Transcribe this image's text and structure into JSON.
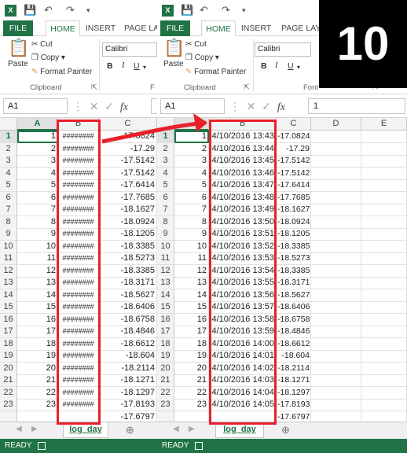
{
  "panes": [
    {
      "id": "paneL",
      "file_label": "FILE",
      "tabs": [
        "HOME",
        "INSERT",
        "PAGE LA"
      ],
      "font_name": "Calibri",
      "name_box": "A1",
      "formula": "",
      "columns": [
        "A",
        "B",
        "C"
      ],
      "col_b_values": [
        "########",
        "########",
        "########",
        "########",
        "########",
        "########",
        "########",
        "########",
        "########",
        "########",
        "########",
        "########",
        "########",
        "########",
        "########",
        "########",
        "########",
        "########",
        "########",
        "########",
        "########",
        "########",
        "########"
      ],
      "sheet_tab": "log_day",
      "status": "READY"
    },
    {
      "id": "paneR",
      "file_label": "FILE",
      "tabs": [
        "HOME",
        "INSERT",
        "PAGE LAYO"
      ],
      "font_name": "Calibri",
      "name_box": "A1",
      "formula": "1",
      "columns": [
        "B",
        "C",
        "D",
        "E"
      ],
      "col_b_values": [
        "4/10/2016 13:43",
        "4/10/2016 13:44",
        "4/10/2016 13:45",
        "4/10/2016 13:46",
        "4/10/2016 13:47",
        "4/10/2016 13:48",
        "4/10/2016 13:49",
        "4/10/2016 13:50",
        "4/10/2016 13:51",
        "4/10/2016 13:52",
        "4/10/2016 13:53",
        "4/10/2016 13:54",
        "4/10/2016 13:55",
        "4/10/2016 13:56",
        "4/10/2016 13:57",
        "4/10/2016 13:58",
        "4/10/2016 13:59",
        "4/10/2016 14:00",
        "4/10/2016 14:01",
        "4/10/2016 14:02",
        "4/10/2016 14:03",
        "4/10/2016 14:04",
        "4/10/2016 14:05"
      ],
      "sheet_tab": "log_day",
      "status": "READY"
    }
  ],
  "ribbon": {
    "cut": "Cut",
    "copy": "Copy",
    "paste": "Paste",
    "format_painter": "Format Painter",
    "clipboard": "Clipboard",
    "font_group": "Font",
    "f_fragment": "F",
    "bold": "B",
    "italic": "I",
    "underline": "U"
  },
  "col_a_values": [
    "1",
    "2",
    "3",
    "4",
    "5",
    "6",
    "7",
    "8",
    "9",
    "10",
    "11",
    "12",
    "13",
    "14",
    "15",
    "16",
    "17",
    "18",
    "19",
    "20",
    "21",
    "22",
    "23"
  ],
  "col_c_values": [
    "-17.0824",
    "-17.29",
    "-17.5142",
    "-17.5142",
    "-17.6414",
    "-17.7685",
    "-18.1627",
    "-18.0924",
    "-18.1205",
    "-18.3385",
    "-18.5273",
    "-18.3385",
    "-18.3171",
    "-18.5627",
    "-18.6406",
    "-18.6758",
    "-18.4846",
    "-18.6612",
    "-18.604",
    "-18.2114",
    "-18.1271",
    "-18.1297",
    "-17.8193"
  ],
  "partial_last_value": "-17.6797",
  "badge": "10",
  "colors": {
    "excel_green": "#217346",
    "highlight_red": "#e8202a"
  }
}
